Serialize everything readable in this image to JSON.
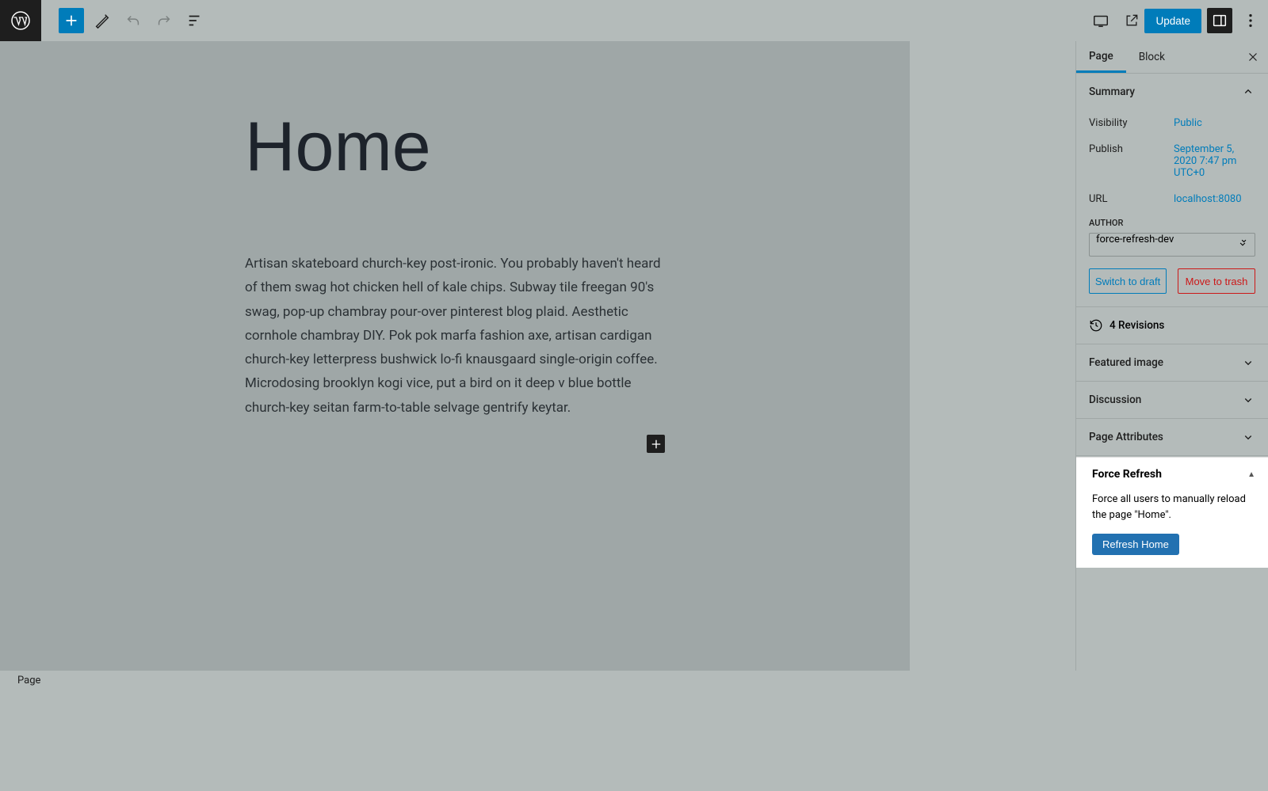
{
  "toolbar": {
    "update_label": "Update"
  },
  "editor": {
    "title": "Home",
    "content": "Artisan skateboard church-key post-ironic. You probably haven't heard of them swag hot chicken hell of kale chips. Subway tile freegan 90's swag, pop-up chambray pour-over pinterest blog plaid. Aesthetic cornhole chambray DIY. Pok pok marfa fashion axe, artisan cardigan church-key letterpress bushwick lo-fi knausgaard single-origin coffee. Microdosing brooklyn kogi vice, put a bird on it deep v blue bottle church-key seitan farm-to-table selvage gentrify keytar."
  },
  "breadcrumb": "Page",
  "sidebar": {
    "tabs": {
      "page": "Page",
      "block": "Block"
    },
    "summary": {
      "title": "Summary",
      "visibility_label": "Visibility",
      "visibility_value": "Public",
      "publish_label": "Publish",
      "publish_value": "September 5, 2020 7:47 pm UTC+0",
      "url_label": "URL",
      "url_value": "localhost:8080",
      "author_label": "AUTHOR",
      "author_value": "force-refresh-dev",
      "switch_draft": "Switch to draft",
      "move_trash": "Move to trash"
    },
    "revisions": "4 Revisions",
    "featured_image": "Featured image",
    "discussion": "Discussion",
    "page_attributes": "Page Attributes",
    "force_refresh": {
      "title": "Force Refresh",
      "description": "Force all users to manually reload the page \"Home\".",
      "button": "Refresh Home"
    }
  }
}
